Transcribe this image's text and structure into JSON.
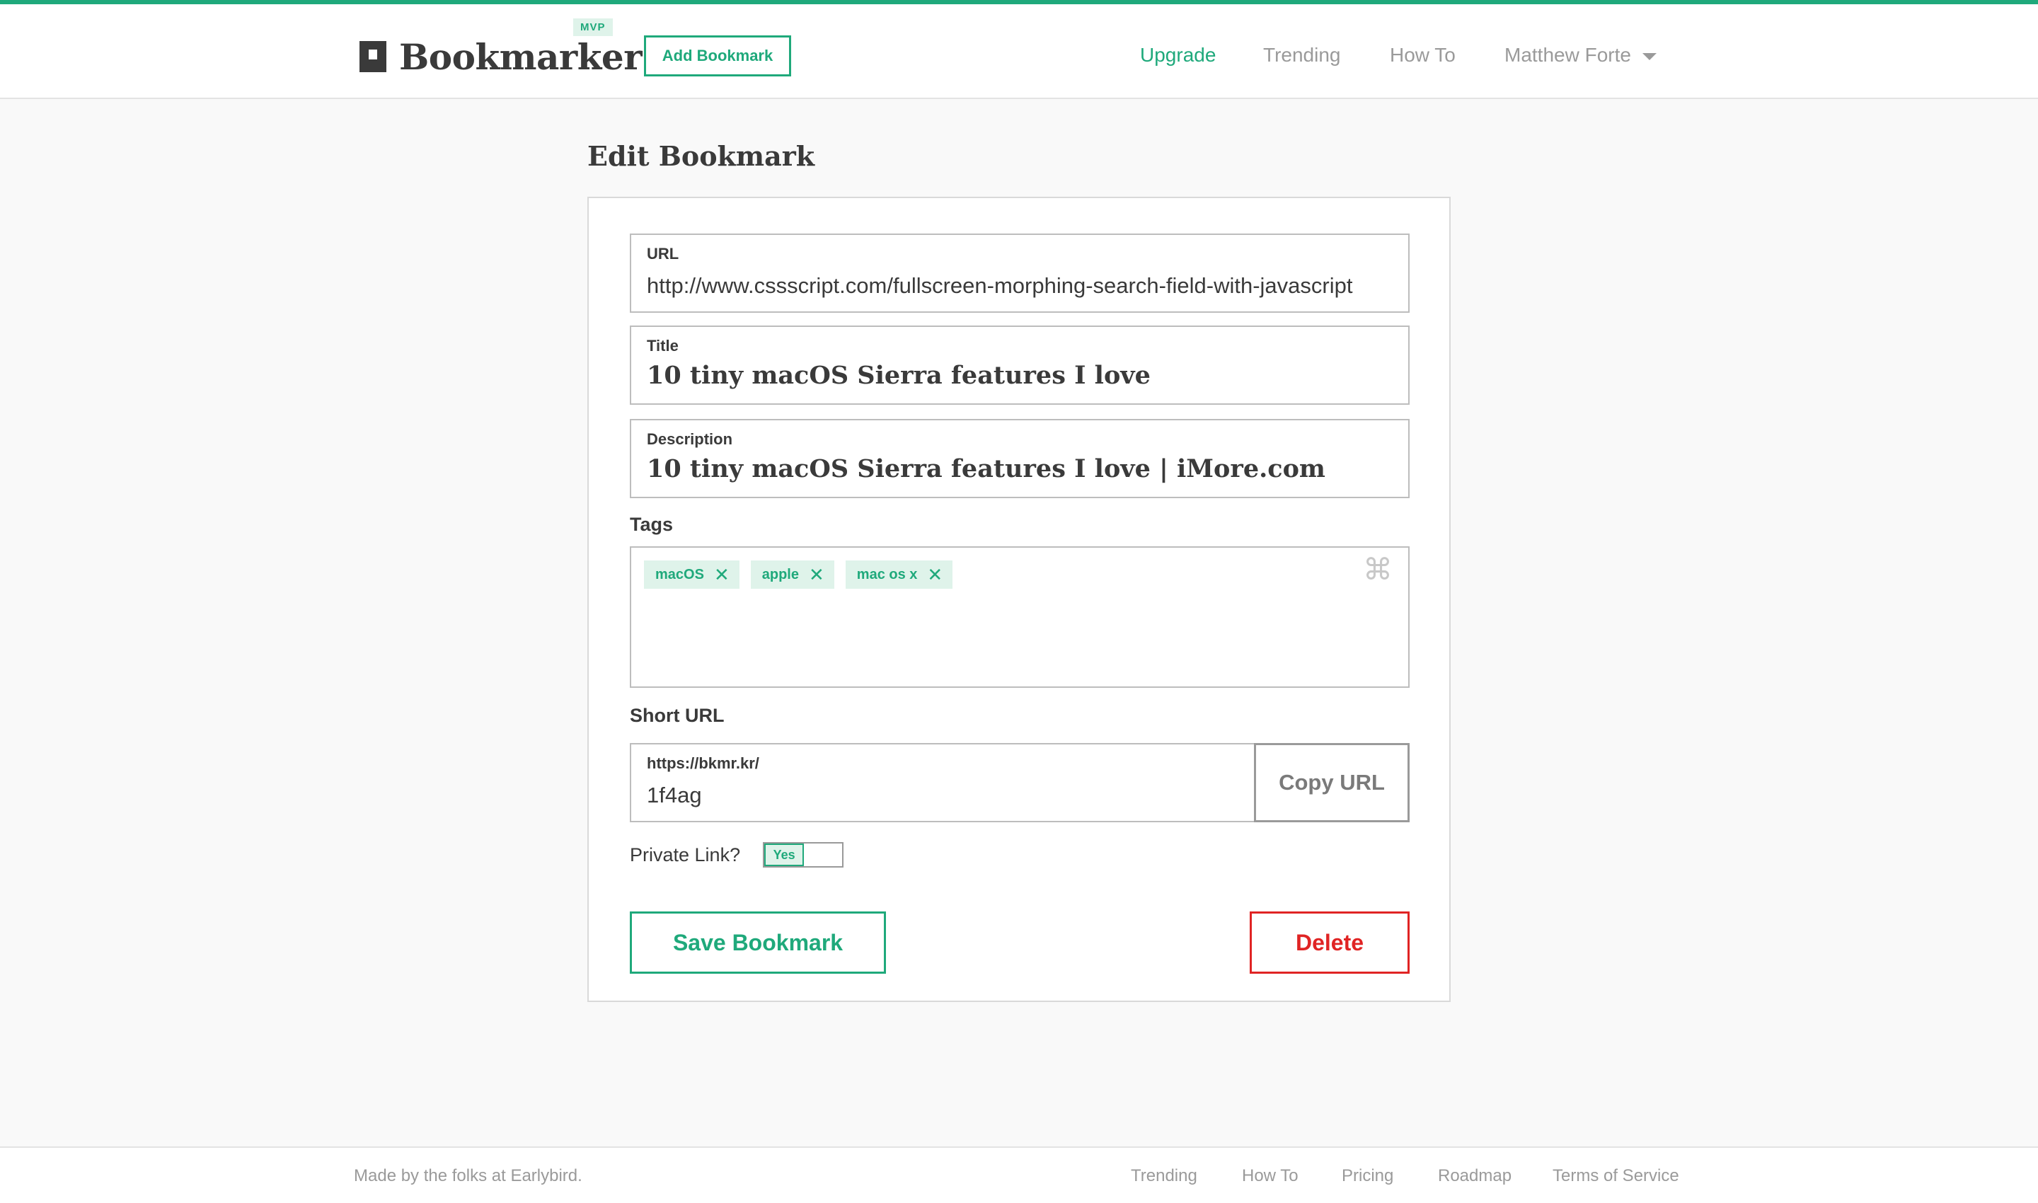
{
  "header": {
    "logo_text": "Bookmarker",
    "badge": "MVP",
    "add_button": "Add Bookmark",
    "nav": {
      "upgrade": "Upgrade",
      "trending": "Trending",
      "howto": "How To",
      "user": "Matthew Forte"
    }
  },
  "main": {
    "title": "Edit Bookmark",
    "url": {
      "label": "URL",
      "value": "http://www.cssscript.com/fullscreen-morphing-search-field-with-javascript"
    },
    "bm_title": {
      "label": "Title",
      "value": "10 tiny macOS Sierra features I love"
    },
    "description": {
      "label": "Description",
      "value": "10 tiny macOS Sierra features I love | iMore.com"
    },
    "tags": {
      "label": "Tags",
      "items": [
        "macOS",
        "apple",
        "mac os x"
      ],
      "remove_glyph": "✕",
      "shortcut_glyph": "⌘"
    },
    "short_url": {
      "label": "Short URL",
      "prefix": "https://bkmr.kr/",
      "value": "1f4ag",
      "copy_button": "Copy URL"
    },
    "private_link": {
      "label": "Private Link?",
      "toggle_text": "Yes",
      "value": true
    },
    "save_button": "Save Bookmark",
    "delete_button": "Delete"
  },
  "footer": {
    "made_by": "Made by the folks at Earlybird.",
    "links": [
      "Trending",
      "How To",
      "Pricing",
      "Roadmap",
      "Terms of Service"
    ]
  },
  "colors": {
    "accent": "#1fa97b",
    "danger": "#e02424",
    "tag_bg": "#dff3ea"
  }
}
